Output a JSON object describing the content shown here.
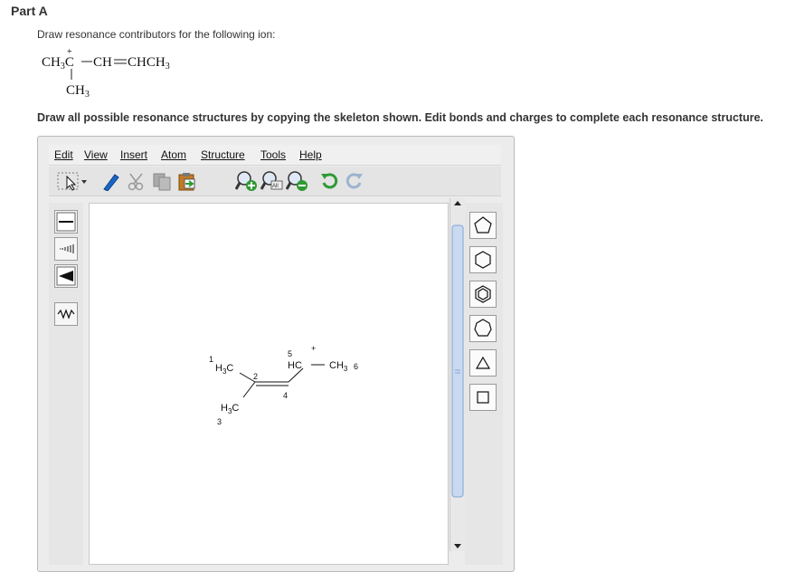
{
  "part_title": "Part A",
  "prompt": "Draw resonance contributors for the following ion:",
  "formula": {
    "left_group": "CH3C",
    "charge": "+",
    "right_chain": "CH=CHCH3",
    "substituent": "CH3"
  },
  "instruction": "Draw all possible resonance structures by copying the skeleton shown. Edit bonds and charges to complete each resonance structure.",
  "editor": {
    "menu": [
      "Edit",
      "View",
      "Insert",
      "Atom",
      "Structure",
      "Tools",
      "Help"
    ],
    "toolbar_icons": [
      "select-arrow-icon",
      "eraser-icon",
      "scissors-icon",
      "copy-icon",
      "paste-icon",
      "zoom-in-icon",
      "zoom-all-icon",
      "zoom-out-icon",
      "undo-icon",
      "redo-icon"
    ],
    "left_tools": [
      "single-bond-icon",
      "hashed-bond-icon",
      "wedge-bond-icon",
      "wavy-bond-icon"
    ],
    "right_tools": [
      "cyclopentane-icon",
      "cyclohexane-icon",
      "benzene-icon",
      "cycloheptane-icon",
      "cyclopropane-icon",
      "cyclobutane-icon"
    ],
    "molecule": {
      "atom1": "H3C",
      "atom3": "H3C",
      "atom5": "HC",
      "atom6": "CH3",
      "charge": "+",
      "numbers": [
        "1",
        "2",
        "3",
        "4",
        "5",
        "6"
      ]
    }
  },
  "colors": {
    "accent": "#1a5dae",
    "green_icon": "#2f9a34",
    "page_bg": "#ffffff",
    "panel_bg": "#ececec"
  }
}
